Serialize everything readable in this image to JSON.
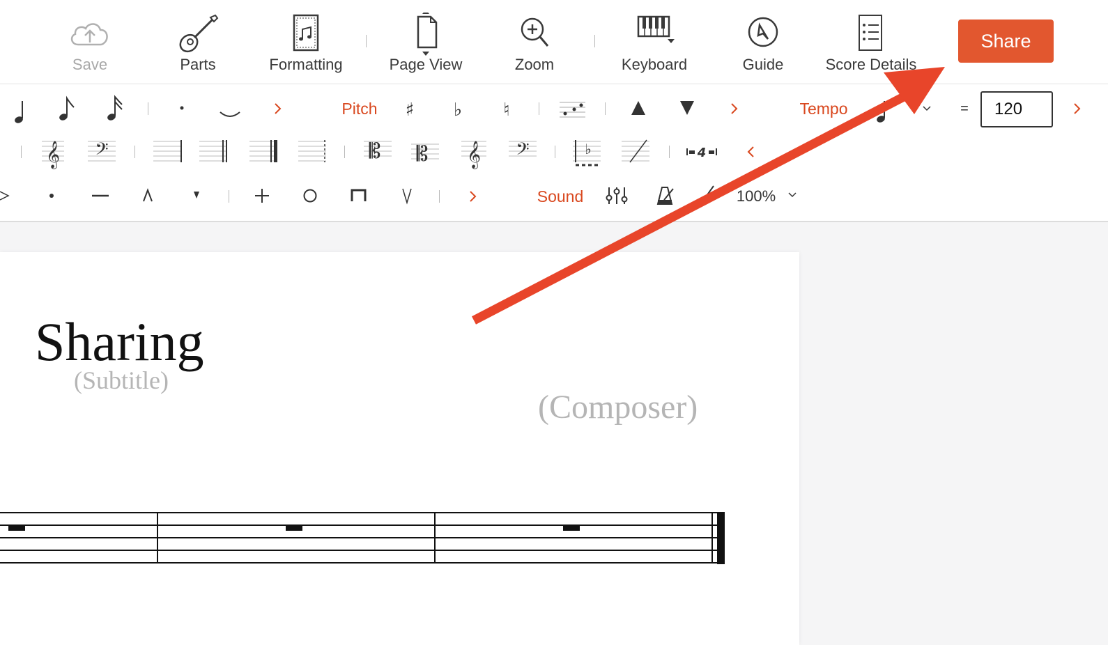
{
  "toolbar": {
    "save": "Save",
    "parts": "Parts",
    "formatting": "Formatting",
    "page_view": "Page View",
    "zoom": "Zoom",
    "keyboard": "Keyboard",
    "guide": "Guide",
    "score_details": "Score Details",
    "share": "Share"
  },
  "palette": {
    "pitch_label": "Pitch",
    "tempo_label": "Tempo",
    "tempo_equals": "=",
    "tempo_value": "120",
    "sound_label": "Sound",
    "volume_percent": "100%"
  },
  "score": {
    "title": "Sharing",
    "subtitle": "(Subtitle)",
    "composer": "(Composer)"
  },
  "icons": [
    "cloud-upload-icon",
    "guitar-icon",
    "page-music-icon",
    "page-view-icon",
    "zoom-in-icon",
    "keyboard-icon",
    "compass-icon",
    "list-icon"
  ],
  "colors": {
    "accent": "#e2572f",
    "arrow": "#e8452a",
    "label_red": "#d9481f"
  }
}
